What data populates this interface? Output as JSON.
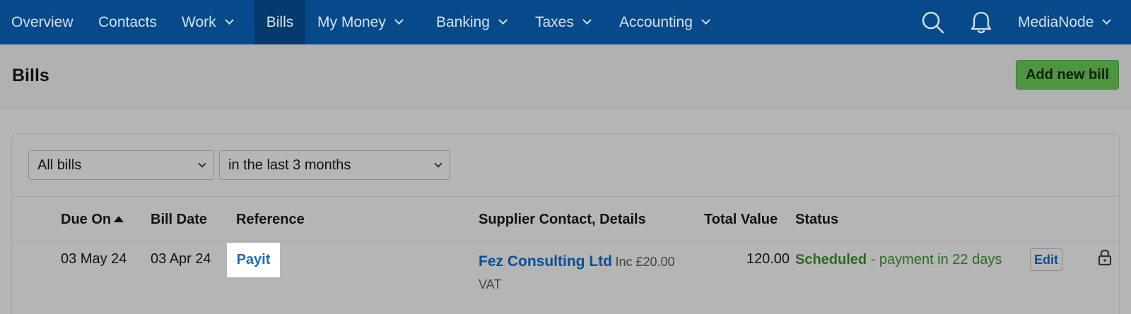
{
  "nav": {
    "items": [
      {
        "label": "Overview",
        "dropdown": false,
        "active": false
      },
      {
        "label": "Contacts",
        "dropdown": false,
        "active": false
      },
      {
        "label": "Work",
        "dropdown": true,
        "active": false
      },
      {
        "label": "Bills",
        "dropdown": false,
        "active": true
      },
      {
        "label": "My Money",
        "dropdown": true,
        "active": false
      },
      {
        "label": "Banking",
        "dropdown": true,
        "active": false
      },
      {
        "label": "Taxes",
        "dropdown": true,
        "active": false
      },
      {
        "label": "Accounting",
        "dropdown": true,
        "active": false
      }
    ],
    "account": "MediaNode",
    "icons": [
      "search-icon",
      "bell-icon"
    ]
  },
  "header": {
    "title": "Bills",
    "add_button": "Add new bill"
  },
  "filters": {
    "type": {
      "selected": "All bills"
    },
    "period": {
      "selected": "in the last 3 months"
    }
  },
  "table": {
    "columns": [
      "Due On",
      "Bill Date",
      "Reference",
      "Supplier Contact, Details",
      "Total Value",
      "Status"
    ],
    "sorted_column": "Due On",
    "sort_direction": "ascending",
    "rows": [
      {
        "due_on": "03 May 24",
        "bill_date": "03 Apr 24",
        "reference": "Payit",
        "supplier": "Fez Consulting Ltd",
        "vat_prefix": "Inc £20.00",
        "vat_suffix": "VAT",
        "total": "120.00",
        "status": "Scheduled",
        "status_detail": " - payment in 22 days",
        "edit": "Edit"
      }
    ]
  },
  "colors": {
    "nav_bg": "#064a8c",
    "accent_green": "#4e9542",
    "link_blue": "#0a4f95",
    "status_green": "#2c6a21"
  }
}
